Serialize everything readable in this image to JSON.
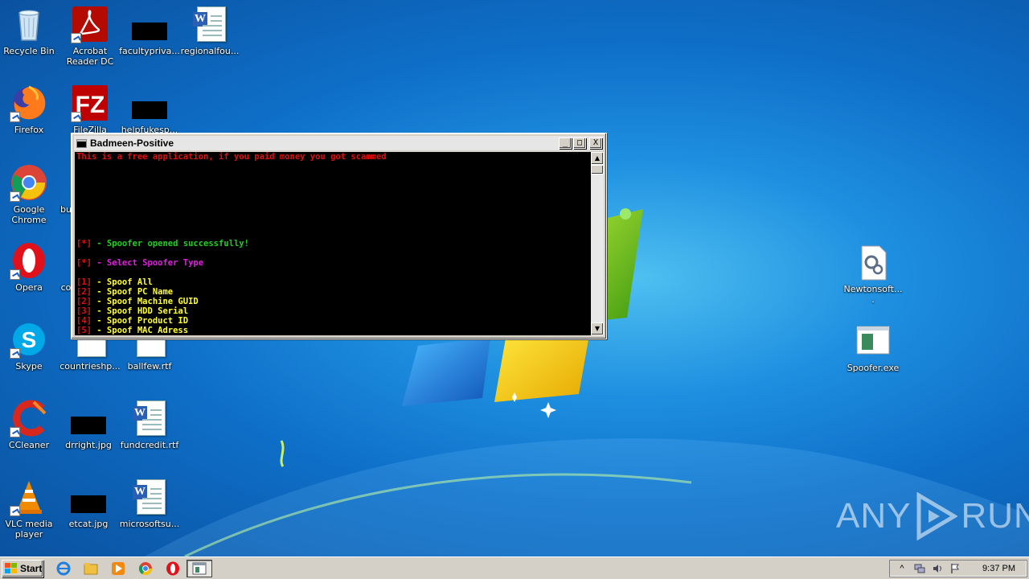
{
  "desktop": {
    "icons": [
      {
        "label": "Recycle Bin",
        "icon": "recycle-bin-icon"
      },
      {
        "label": "Acrobat Reader DC",
        "icon": "acrobat-icon"
      },
      {
        "label": "facultypriva...",
        "icon": "image-file-icon"
      },
      {
        "label": "regionalfou...",
        "icon": "word-doc-icon"
      },
      {
        "label": "Firefox",
        "icon": "firefox-icon"
      },
      {
        "label": "FileZilla Client",
        "icon": "filezilla-icon"
      },
      {
        "label": "helpfukesp...",
        "icon": "image-file-icon"
      },
      {
        "label": "Google Chrome",
        "icon": "chrome-icon"
      },
      {
        "label": "bu",
        "icon": "file-icon"
      },
      {
        "label": "Opera",
        "icon": "opera-icon"
      },
      {
        "label": "co",
        "icon": "file-icon"
      },
      {
        "label": "Skype",
        "icon": "skype-icon"
      },
      {
        "label": "countrieshp...",
        "icon": "word-doc-icon"
      },
      {
        "label": "ballfew.rtf",
        "icon": "word-doc-icon"
      },
      {
        "label": "CCleaner",
        "icon": "ccleaner-icon"
      },
      {
        "label": "drright.jpg",
        "icon": "image-file-icon"
      },
      {
        "label": "fundcredit.rtf",
        "icon": "word-doc-icon"
      },
      {
        "label": "VLC media player",
        "icon": "vlc-icon"
      },
      {
        "label": "etcat.jpg",
        "icon": "image-file-icon"
      },
      {
        "label": "microsoftsu...",
        "icon": "word-doc-icon"
      },
      {
        "label": "Newtonsoft....",
        "icon": "dll-settings-icon"
      },
      {
        "label": "Spoofer.exe",
        "icon": "exe-window-icon"
      }
    ]
  },
  "console": {
    "title": "Badmeen-Positive",
    "buttons": {
      "minimize": "_",
      "maximize": "□",
      "close": "X"
    },
    "lines": [
      {
        "text": "This is a free application, if you paid money you got scammed",
        "color": "#e01010"
      },
      {
        "text": "",
        "color": ""
      },
      {
        "text": "",
        "color": ""
      },
      {
        "text": "",
        "color": ""
      },
      {
        "text": "",
        "color": ""
      },
      {
        "text": "",
        "color": ""
      },
      {
        "text": "",
        "color": ""
      },
      {
        "text": "",
        "color": ""
      },
      {
        "text": "",
        "color": ""
      },
      {
        "prefix": "[*]",
        "text": " - Spoofer opened successfully!",
        "color": "#20d020"
      },
      {
        "text": "",
        "color": ""
      },
      {
        "prefix": "[*]",
        "text": " - Select Spoofer Type",
        "color": "#e020e0"
      },
      {
        "text": "",
        "color": ""
      },
      {
        "prefix": "[1]",
        "text": " - Spoof All",
        "color": "#ffff30"
      },
      {
        "prefix": "[2]",
        "text": " - Spoof PC Name",
        "color": "#ffff30"
      },
      {
        "prefix": "[2]",
        "text": " - Spoof Machine GUID",
        "color": "#ffff30"
      },
      {
        "prefix": "[3]",
        "text": " - Spoof HDD Serial",
        "color": "#ffff30"
      },
      {
        "prefix": "[4]",
        "text": " - Spoof Product ID",
        "color": "#ffff30"
      },
      {
        "prefix": "[5]",
        "text": " - Spoof MAC Adress",
        "color": "#ffff30"
      }
    ]
  },
  "watermark": {
    "left": "ANY",
    "right": "RUN"
  },
  "taskbar": {
    "start_label": "Start",
    "quick_launch": [
      "ie-icon",
      "explorer-icon",
      "media-player-icon",
      "chrome-icon",
      "opera-icon"
    ],
    "active_task": "console-window-icon",
    "clock": "9:37 PM"
  }
}
